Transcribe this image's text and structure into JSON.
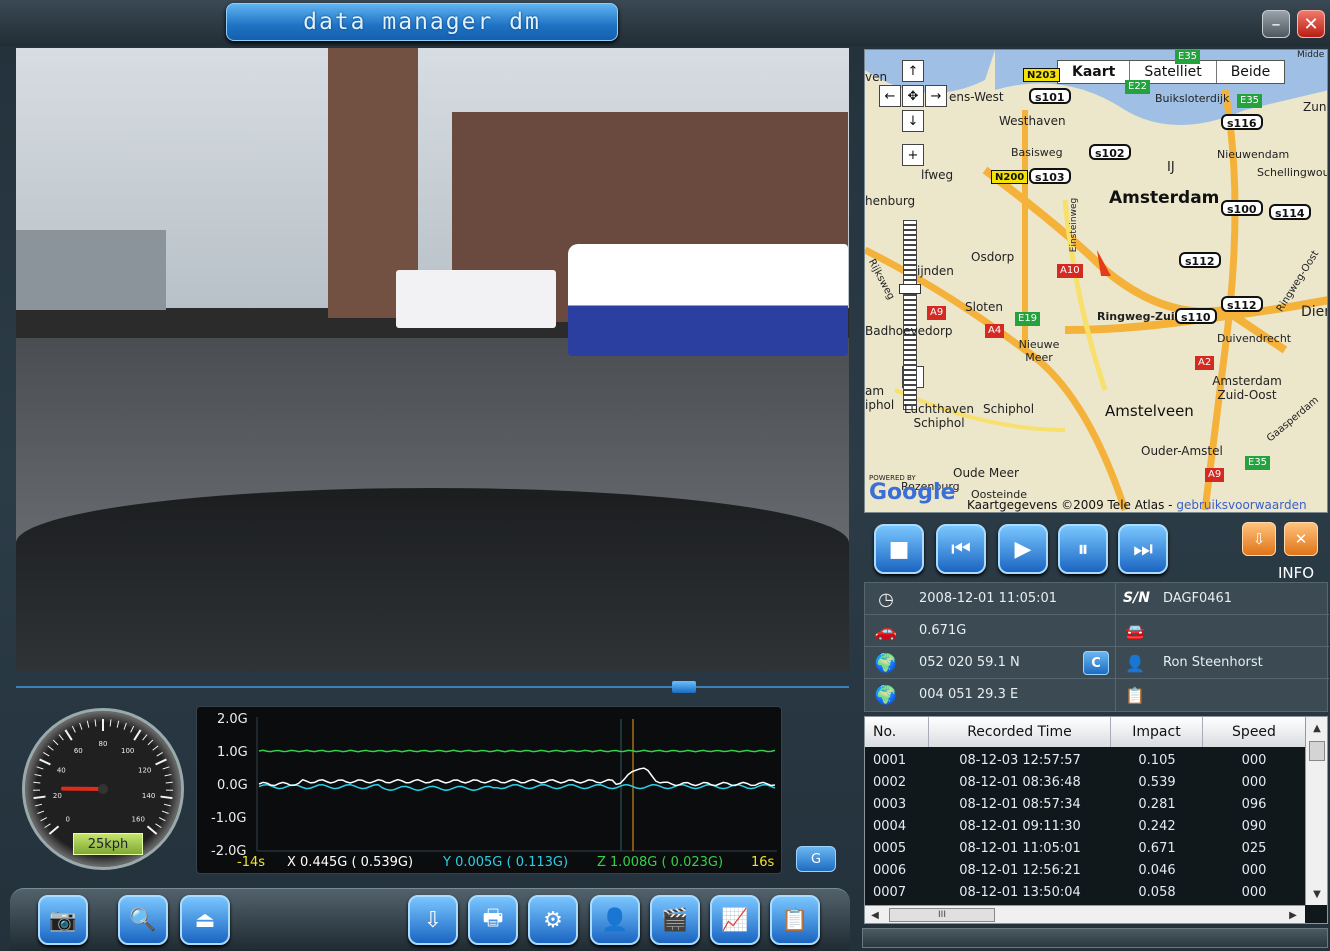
{
  "app": {
    "title": "data manager dm"
  },
  "window": {
    "minimize_icon": "minimize-icon",
    "close_icon": "close-icon"
  },
  "map": {
    "tabs": [
      "Kaart",
      "Satelliet",
      "Beide"
    ],
    "city": "Amsterdam",
    "labels": [
      "ven",
      "ens-West",
      "Westhaven",
      "Basisweg",
      "lfweg",
      "henburg",
      "Osdorp",
      "ijnden",
      "Sloten",
      "Badhoevedorp",
      "Nieuwe Meer",
      "am",
      "iphol",
      "Luchthaven Schiphol",
      "Schiphol",
      "Amstelveen",
      "Ouder-Amstel",
      "Oude Meer",
      "Oosteinde",
      "Buiksloterdijk",
      "Zun",
      "Nieuwendam",
      "Schellingwou",
      "Duivendrecht",
      "Amsterdam Zuid-Oost",
      "Dier",
      "Ringweg-Zuid",
      "Ringweg-Oost",
      "Gaasperdam",
      "Rijksweg",
      "Einsteinweg",
      "IJ",
      "Midde",
      "Rozenburg"
    ],
    "shields_white": [
      "s101",
      "s102",
      "s103",
      "s116",
      "s100",
      "s114",
      "s112",
      "s112",
      "s110"
    ],
    "shields_yellow": [
      "N203",
      "N200"
    ],
    "shields_red": [
      "A10",
      "A9",
      "A4",
      "A2",
      "A9"
    ],
    "shields_green": [
      "E22",
      "E35",
      "E19",
      "E35",
      "E35"
    ],
    "powered_by": "POWERED BY",
    "google": "Google",
    "copyright": "Kaartgegevens ©2009 Tele Atlas - ",
    "terms_link": "gebruiksvoorwaarden"
  },
  "playback": {
    "buttons": [
      "stop",
      "previous",
      "play",
      "pause",
      "next"
    ],
    "info_label": "INFO"
  },
  "info": {
    "datetime": "2008-12-01  11:05:01",
    "sn_label": "S/N",
    "serial": "DAGF0461",
    "impact": "0.671G",
    "latitude": "052 020 59.1 N",
    "longitude": "004 051 29.3 E",
    "c_button": "C",
    "driver": "Ron Steenhorst"
  },
  "table": {
    "columns": [
      "No.",
      "Recorded Time",
      "Impact",
      "Speed"
    ],
    "rows": [
      [
        "0001",
        "08-12-03  12:57:57",
        "0.105",
        "000"
      ],
      [
        "0002",
        "08-12-01  08:36:48",
        "0.539",
        "000"
      ],
      [
        "0003",
        "08-12-01  08:57:34",
        "0.281",
        "096"
      ],
      [
        "0004",
        "08-12-01  09:11:30",
        "0.242",
        "090"
      ],
      [
        "0005",
        "08-12-01  11:05:01",
        "0.671",
        "025"
      ],
      [
        "0006",
        "08-12-01  12:56:21",
        "0.046",
        "000"
      ],
      [
        "0007",
        "08-12-01  13:50:04",
        "0.058",
        "000"
      ]
    ],
    "hscroll_grip": "III"
  },
  "speedometer": {
    "readout": "25kph",
    "ticks": [
      "0",
      "20",
      "40",
      "60",
      "80",
      "100",
      "120",
      "140",
      "160"
    ],
    "speed": 25
  },
  "graph": {
    "y_ticks": [
      "2.0G",
      "1.0G",
      "0.0G",
      "-1.0G",
      "-2.0G"
    ],
    "x_start": "-14s",
    "x_end": "16s",
    "x_axis_label": "X 0.445G ( 0.539G)",
    "y_axis_label": "Y 0.005G ( 0.113G)",
    "z_axis_label": "Z 1.008G ( 0.023G)",
    "g_button": "G",
    "colors": {
      "x": "#ffffff",
      "y": "#2ad0e6",
      "z": "#35d04a",
      "marker": "#f2a11b"
    }
  },
  "toolbar": {
    "icons": [
      "camera-icon",
      "search-icon",
      "eject-icon",
      "download-icon",
      "print-icon",
      "settings-icon",
      "user-settings-icon",
      "clapper-icon",
      "chart-icon",
      "report-icon"
    ]
  }
}
